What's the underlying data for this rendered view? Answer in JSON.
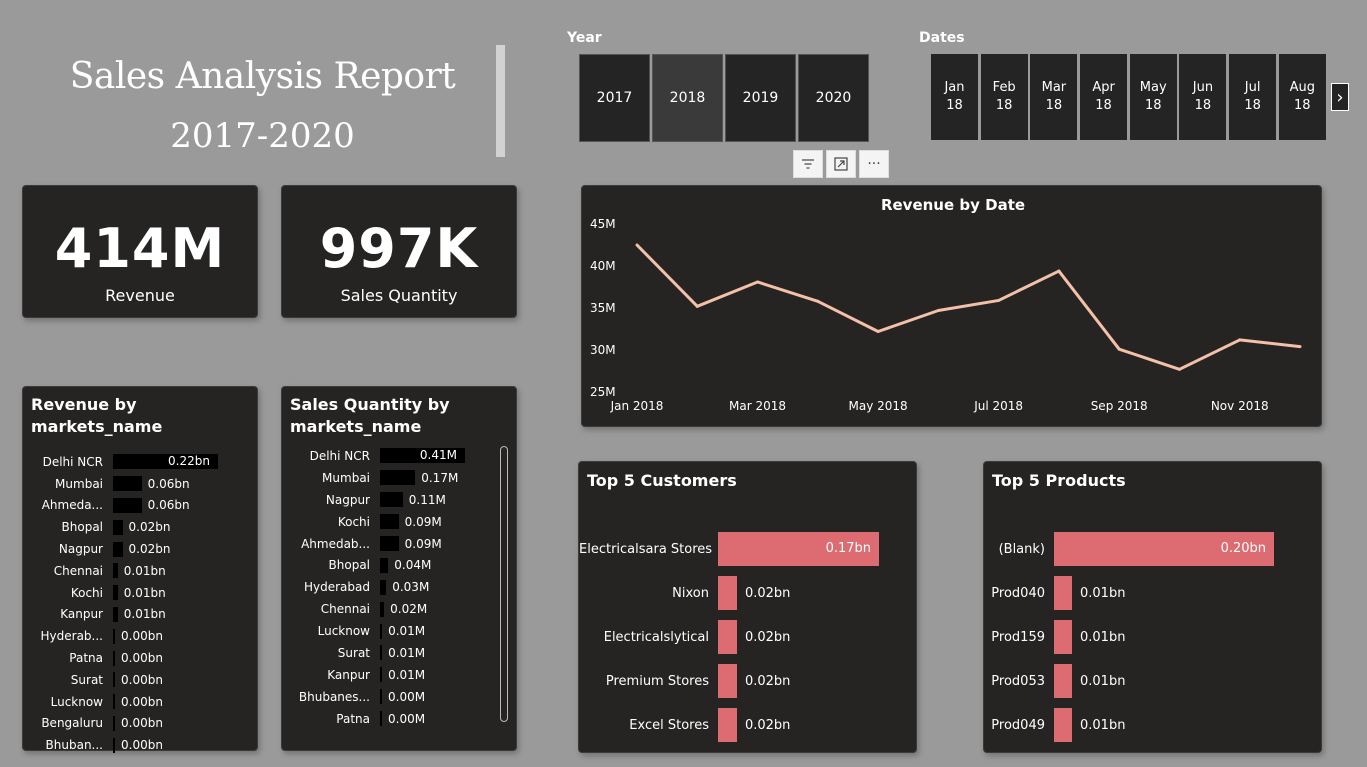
{
  "header": {
    "title": "Sales Analysis Report",
    "subtitle": "2017-2020"
  },
  "year_slicer": {
    "label": "Year",
    "options": [
      "2017",
      "2018",
      "2019",
      "2020"
    ],
    "selected": "2018"
  },
  "date_slicer": {
    "label": "Dates",
    "options": [
      {
        "month": "Jan",
        "year": "18"
      },
      {
        "month": "Feb",
        "year": "18"
      },
      {
        "month": "Mar",
        "year": "18"
      },
      {
        "month": "Apr",
        "year": "18"
      },
      {
        "month": "May",
        "year": "18"
      },
      {
        "month": "Jun",
        "year": "18"
      },
      {
        "month": "Jul",
        "year": "18"
      },
      {
        "month": "Aug",
        "year": "18"
      }
    ],
    "next_icon": "chevron-right-icon"
  },
  "toolbar": {
    "icons": [
      "filter-icon",
      "focus-mode-icon",
      "more-options-icon"
    ]
  },
  "kpis": {
    "revenue": {
      "value": "414M",
      "label": "Revenue"
    },
    "quantity": {
      "value": "997K",
      "label": "Sales Quantity"
    }
  },
  "revenue_by_market": {
    "title": "Revenue by markets_name",
    "rows": [
      {
        "name": "Delhi NCR",
        "value": 0.22,
        "label": "0.22bn"
      },
      {
        "name": "Mumbai",
        "value": 0.06,
        "label": "0.06bn"
      },
      {
        "name": "Ahmeda...",
        "value": 0.06,
        "label": "0.06bn"
      },
      {
        "name": "Bhopal",
        "value": 0.02,
        "label": "0.02bn"
      },
      {
        "name": "Nagpur",
        "value": 0.02,
        "label": "0.02bn"
      },
      {
        "name": "Chennai",
        "value": 0.01,
        "label": "0.01bn"
      },
      {
        "name": "Kochi",
        "value": 0.01,
        "label": "0.01bn"
      },
      {
        "name": "Kanpur",
        "value": 0.01,
        "label": "0.01bn"
      },
      {
        "name": "Hyderab...",
        "value": 0.0,
        "label": "0.00bn"
      },
      {
        "name": "Patna",
        "value": 0.0,
        "label": "0.00bn"
      },
      {
        "name": "Surat",
        "value": 0.0,
        "label": "0.00bn"
      },
      {
        "name": "Lucknow",
        "value": 0.0,
        "label": "0.00bn"
      },
      {
        "name": "Bengaluru",
        "value": 0.0,
        "label": "0.00bn"
      },
      {
        "name": "Bhuban...",
        "value": 0.0,
        "label": "0.00bn"
      }
    ]
  },
  "quantity_by_market": {
    "title": "Sales Quantity by markets_name",
    "rows": [
      {
        "name": "Delhi NCR",
        "value": 0.41,
        "label": "0.41M"
      },
      {
        "name": "Mumbai",
        "value": 0.17,
        "label": "0.17M"
      },
      {
        "name": "Nagpur",
        "value": 0.11,
        "label": "0.11M"
      },
      {
        "name": "Kochi",
        "value": 0.09,
        "label": "0.09M"
      },
      {
        "name": "Ahmedab...",
        "value": 0.09,
        "label": "0.09M"
      },
      {
        "name": "Bhopal",
        "value": 0.04,
        "label": "0.04M"
      },
      {
        "name": "Hyderabad",
        "value": 0.03,
        "label": "0.03M"
      },
      {
        "name": "Chennai",
        "value": 0.02,
        "label": "0.02M"
      },
      {
        "name": "Lucknow",
        "value": 0.01,
        "label": "0.01M"
      },
      {
        "name": "Surat",
        "value": 0.01,
        "label": "0.01M"
      },
      {
        "name": "Kanpur",
        "value": 0.01,
        "label": "0.01M"
      },
      {
        "name": "Bhubanes...",
        "value": 0.0,
        "label": "0.00M"
      },
      {
        "name": "Patna",
        "value": 0.0,
        "label": "0.00M"
      }
    ]
  },
  "top_customers": {
    "title": "Top 5 Customers",
    "rows": [
      {
        "name": "Electricalsara Stores",
        "value": 0.17,
        "label": "0.17bn"
      },
      {
        "name": "Nixon",
        "value": 0.02,
        "label": "0.02bn"
      },
      {
        "name": "Electricalslytical",
        "value": 0.02,
        "label": "0.02bn"
      },
      {
        "name": "Premium Stores",
        "value": 0.02,
        "label": "0.02bn"
      },
      {
        "name": "Excel Stores",
        "value": 0.02,
        "label": "0.02bn"
      }
    ]
  },
  "top_products": {
    "title": "Top 5 Products",
    "rows": [
      {
        "name": "(Blank)",
        "value": 0.2,
        "label": "0.20bn"
      },
      {
        "name": "Prod040",
        "value": 0.01,
        "label": "0.01bn"
      },
      {
        "name": "Prod159",
        "value": 0.01,
        "label": "0.01bn"
      },
      {
        "name": "Prod053",
        "value": 0.01,
        "label": "0.01bn"
      },
      {
        "name": "Prod049",
        "value": 0.01,
        "label": "0.01bn"
      }
    ]
  },
  "colors": {
    "line": "#f4c0a8",
    "accent_bar": "#dd6b72",
    "card_bg": "#252423",
    "page_bg": "#9a9a9a"
  },
  "chart_data": {
    "type": "line",
    "title": "Revenue by Date",
    "x": [
      "Jan 2018",
      "Feb 2018",
      "Mar 2018",
      "Apr 2018",
      "May 2018",
      "Jun 2018",
      "Jul 2018",
      "Aug 2018",
      "Sep 2018",
      "Oct 2018",
      "Nov 2018",
      "Dec 2018"
    ],
    "x_tick_labels": [
      "Jan 2018",
      "Mar 2018",
      "May 2018",
      "Jul 2018",
      "Sep 2018",
      "Nov 2018"
    ],
    "series": [
      {
        "values": [
          42.5,
          35.2,
          38.1,
          35.8,
          32.2,
          34.7,
          35.9,
          39.4,
          30.1,
          27.7,
          31.2,
          30.4
        ]
      }
    ],
    "y_ticks": [
      "45M",
      "40M",
      "35M",
      "30M",
      "25M"
    ],
    "ylim": [
      25,
      45
    ],
    "grid": false
  }
}
